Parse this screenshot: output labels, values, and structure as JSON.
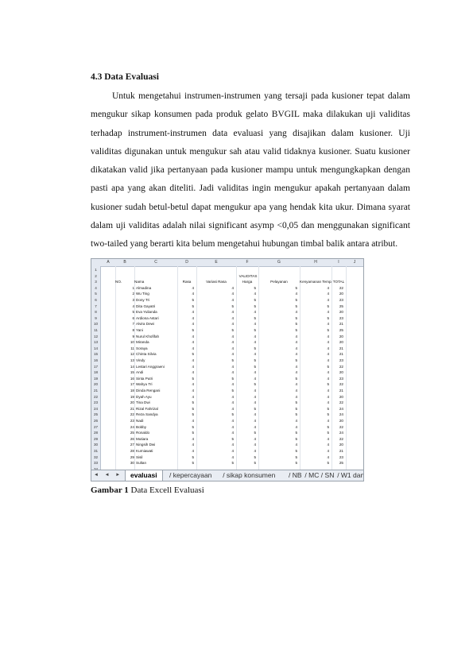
{
  "section_heading": "4.3 Data Evaluasi",
  "paragraph": "Untuk mengetahui instrumen-instrumen yang tersaji pada kusioner tepat dalam mengukur sikap konsumen pada produk gelato BVGIL maka dilakukan uji validitas terhadap instrument-instrumen data evaluasi yang disajikan dalam kusioner. Uji validitas digunakan untuk mengukur sah atau valid tidaknya kusioner. Suatu kusioner dikatakan valid jika pertanyaan pada kusioner mampu untuk mengungkapkan dengan pasti apa yang akan diteliti. Jadi validitas ingin mengukur apakah pertanyaan dalam kusioner sudah betul-betul dapat mengukur apa yang hendak kita ukur. Dimana syarat dalam uji validitas adalah nilai significant asymp <0,05 dan menggunakan significant two-tailed yang berarti kita belum mengetahui hubungan timbal balik antara atribut.",
  "spreadsheet": {
    "column_letters": [
      "A",
      "B",
      "C",
      "D",
      "E",
      "F",
      "G",
      "H",
      "I",
      "J"
    ],
    "merged_title": "VALIDITAS",
    "header_row": [
      "NO.",
      "Nama",
      "Rasa",
      "Variasi Rasa",
      "Harga",
      "Pelayanan",
      "Kenyamanan Tempat",
      "TOTAL"
    ],
    "rows": [
      {
        "no": "1",
        "nama": "Almadina",
        "v": [
          "4",
          "4",
          "5",
          "5",
          "4",
          "22"
        ]
      },
      {
        "no": "2",
        "nama": "Wu Ting",
        "v": [
          "4",
          "4",
          "4",
          "4",
          "4",
          "20"
        ]
      },
      {
        "no": "3",
        "nama": "Dony Tri",
        "v": [
          "5",
          "4",
          "5",
          "5",
          "4",
          "23"
        ]
      },
      {
        "no": "4",
        "nama": "Dita Gayatri",
        "v": [
          "5",
          "5",
          "5",
          "5",
          "5",
          "25"
        ]
      },
      {
        "no": "5",
        "nama": "Eva Yulianda",
        "v": [
          "4",
          "4",
          "4",
          "4",
          "4",
          "20"
        ]
      },
      {
        "no": "6",
        "nama": "Ardiona Astari",
        "v": [
          "4",
          "4",
          "5",
          "5",
          "5",
          "23"
        ]
      },
      {
        "no": "7",
        "nama": "Alvira Dewi",
        "v": [
          "4",
          "4",
          "4",
          "5",
          "4",
          "21"
        ]
      },
      {
        "no": "8",
        "nama": "Yani",
        "v": [
          "5",
          "5",
          "5",
          "5",
          "5",
          "25"
        ]
      },
      {
        "no": "9",
        "nama": "Nurul Khofifah",
        "v": [
          "4",
          "4",
          "4",
          "4",
          "4",
          "20"
        ]
      },
      {
        "no": "10",
        "nama": "Miranda",
        "v": [
          "4",
          "4",
          "4",
          "4",
          "4",
          "20"
        ]
      },
      {
        "no": "11",
        "nama": "Soraya",
        "v": [
          "4",
          "4",
          "5",
          "4",
          "4",
          "21"
        ]
      },
      {
        "no": "12",
        "nama": "Chinta Silvia",
        "v": [
          "5",
          "4",
          "4",
          "4",
          "4",
          "21"
        ]
      },
      {
        "no": "13",
        "nama": "Vindy",
        "v": [
          "4",
          "5",
          "5",
          "5",
          "4",
          "23"
        ]
      },
      {
        "no": "14",
        "nama": "Lestari Anggraeni",
        "v": [
          "4",
          "4",
          "5",
          "4",
          "5",
          "22"
        ]
      },
      {
        "no": "15",
        "nama": "Andi",
        "v": [
          "4",
          "4",
          "4",
          "4",
          "4",
          "20"
        ]
      },
      {
        "no": "16",
        "nama": "Sinta Putri",
        "v": [
          "5",
          "5",
          "4",
          "5",
          "4",
          "23"
        ]
      },
      {
        "no": "17",
        "nama": "Wahyu Tri",
        "v": [
          "4",
          "4",
          "5",
          "4",
          "5",
          "22"
        ]
      },
      {
        "no": "18",
        "nama": "Dinda Rengani",
        "v": [
          "4",
          "5",
          "4",
          "4",
          "4",
          "21"
        ]
      },
      {
        "no": "19",
        "nama": "Dyah Ayu",
        "v": [
          "4",
          "4",
          "4",
          "4",
          "4",
          "20"
        ]
      },
      {
        "no": "20",
        "nama": "Tina Dwi",
        "v": [
          "5",
          "4",
          "4",
          "5",
          "4",
          "22"
        ]
      },
      {
        "no": "21",
        "nama": "Rizal Fahrizal",
        "v": [
          "5",
          "4",
          "5",
          "5",
          "5",
          "24"
        ]
      },
      {
        "no": "22",
        "nama": "Reza Sandya",
        "v": [
          "5",
          "5",
          "4",
          "5",
          "5",
          "24"
        ]
      },
      {
        "no": "23",
        "nama": "Nadi",
        "v": [
          "4",
          "4",
          "4",
          "4",
          "4",
          "20"
        ]
      },
      {
        "no": "24",
        "nama": "Bobby",
        "v": [
          "5",
          "4",
          "4",
          "4",
          "5",
          "22"
        ]
      },
      {
        "no": "25",
        "nama": "Ronaldo",
        "v": [
          "5",
          "4",
          "5",
          "5",
          "5",
          "24"
        ]
      },
      {
        "no": "26",
        "nama": "Mutiara",
        "v": [
          "4",
          "5",
          "4",
          "5",
          "4",
          "22"
        ]
      },
      {
        "no": "27",
        "nama": "Ningsih Dwi",
        "v": [
          "4",
          "4",
          "4",
          "4",
          "4",
          "20"
        ]
      },
      {
        "no": "28",
        "nama": "Kurniawati",
        "v": [
          "4",
          "4",
          "4",
          "5",
          "4",
          "21"
        ]
      },
      {
        "no": "29",
        "nama": "Sisil",
        "v": [
          "5",
          "4",
          "5",
          "5",
          "4",
          "23"
        ]
      },
      {
        "no": "30",
        "nama": "Sultan",
        "v": [
          "5",
          "5",
          "5",
          "5",
          "5",
          "25"
        ]
      }
    ],
    "tabs": [
      {
        "label": "evaluasi",
        "active": true
      },
      {
        "label": "kepercayaan",
        "active": false
      },
      {
        "label": "sikap konsumen",
        "active": false
      },
      {
        "label": "NB",
        "active": false
      },
      {
        "label": "MC",
        "active": false
      },
      {
        "label": "SN",
        "active": false
      },
      {
        "label": "W1 dan W",
        "active": false
      }
    ],
    "tab_nav": "◄ ◄ ► ►"
  },
  "caption": {
    "label": "Gambar 1",
    "text": "Data Excell Evaluasi"
  }
}
